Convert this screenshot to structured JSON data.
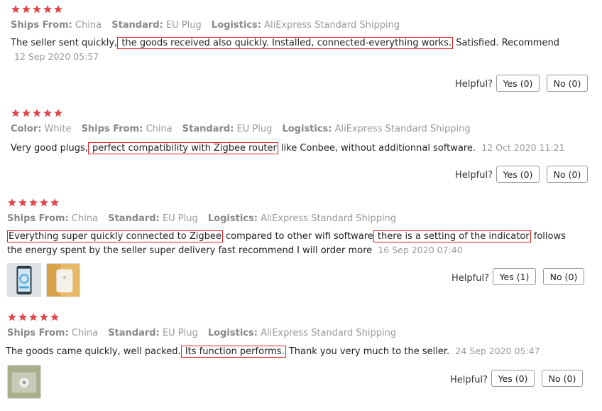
{
  "colors": {
    "star": "#e2474b",
    "highlight": "#e02020",
    "meta": "#999999"
  },
  "reviews": [
    {
      "rating": 5,
      "props": [
        {
          "key": "Ships From:",
          "value": "China"
        },
        {
          "key": "Standard:",
          "value": "EU Plug"
        },
        {
          "key": "Logistics:",
          "value": "AliExpress Standard Shipping"
        }
      ],
      "text1a": "The seller sent quickly,",
      "hl1": " the goods received also quickly. Installed, connected-everything works.",
      "text1b": " Satisfied. Recommend",
      "date": "12 Sep 2020 05:57",
      "helpful_label": "Helpful?",
      "yes_label": "Yes (0)",
      "no_label": "No (0)"
    },
    {
      "rating": 5,
      "props": [
        {
          "key": "Color:",
          "value": "White"
        },
        {
          "key": "Ships From:",
          "value": "China"
        },
        {
          "key": "Standard:",
          "value": "EU Plug"
        },
        {
          "key": "Logistics:",
          "value": "AliExpress Standard Shipping"
        }
      ],
      "text1a": "Very good plugs,",
      "hl1": " perfect compatibility with Zigbee router",
      "text1b": " like Conbee, without additionnal software.",
      "date": "12 Oct 2020 11:21",
      "helpful_label": "Helpful?",
      "yes_label": "Yes (0)",
      "no_label": "No (0)"
    },
    {
      "rating": 5,
      "props": [
        {
          "key": "Ships From:",
          "value": "China"
        },
        {
          "key": "Standard:",
          "value": "EU Plug"
        },
        {
          "key": "Logistics:",
          "value": "AliExpress Standard Shipping"
        }
      ],
      "hl1": "Everything super quickly connected to Zigbee",
      "text1b": " compared to other wifi software",
      "hl2": " there is a setting of the indicator",
      "text1c": " follows",
      "text2": "the energy spent by the seller super delivery fast recommend I will order more",
      "date": "16 Sep 2020 07:40",
      "helpful_label": "Helpful?",
      "yes_label": "Yes (1)",
      "no_label": "No (0)"
    },
    {
      "rating": 5,
      "props": [
        {
          "key": "Ships From:",
          "value": "China"
        },
        {
          "key": "Standard:",
          "value": "EU Plug"
        },
        {
          "key": "Logistics:",
          "value": "AliExpress Standard Shipping"
        }
      ],
      "text1a": "The goods came quickly, well packed.",
      "hl1": " Its function performs.",
      "text1b": " Thank you very much to the seller.",
      "date": "24 Sep 2020 05:47",
      "helpful_label": "Helpful?",
      "yes_label": "Yes (0)",
      "no_label": "No (0)"
    }
  ]
}
